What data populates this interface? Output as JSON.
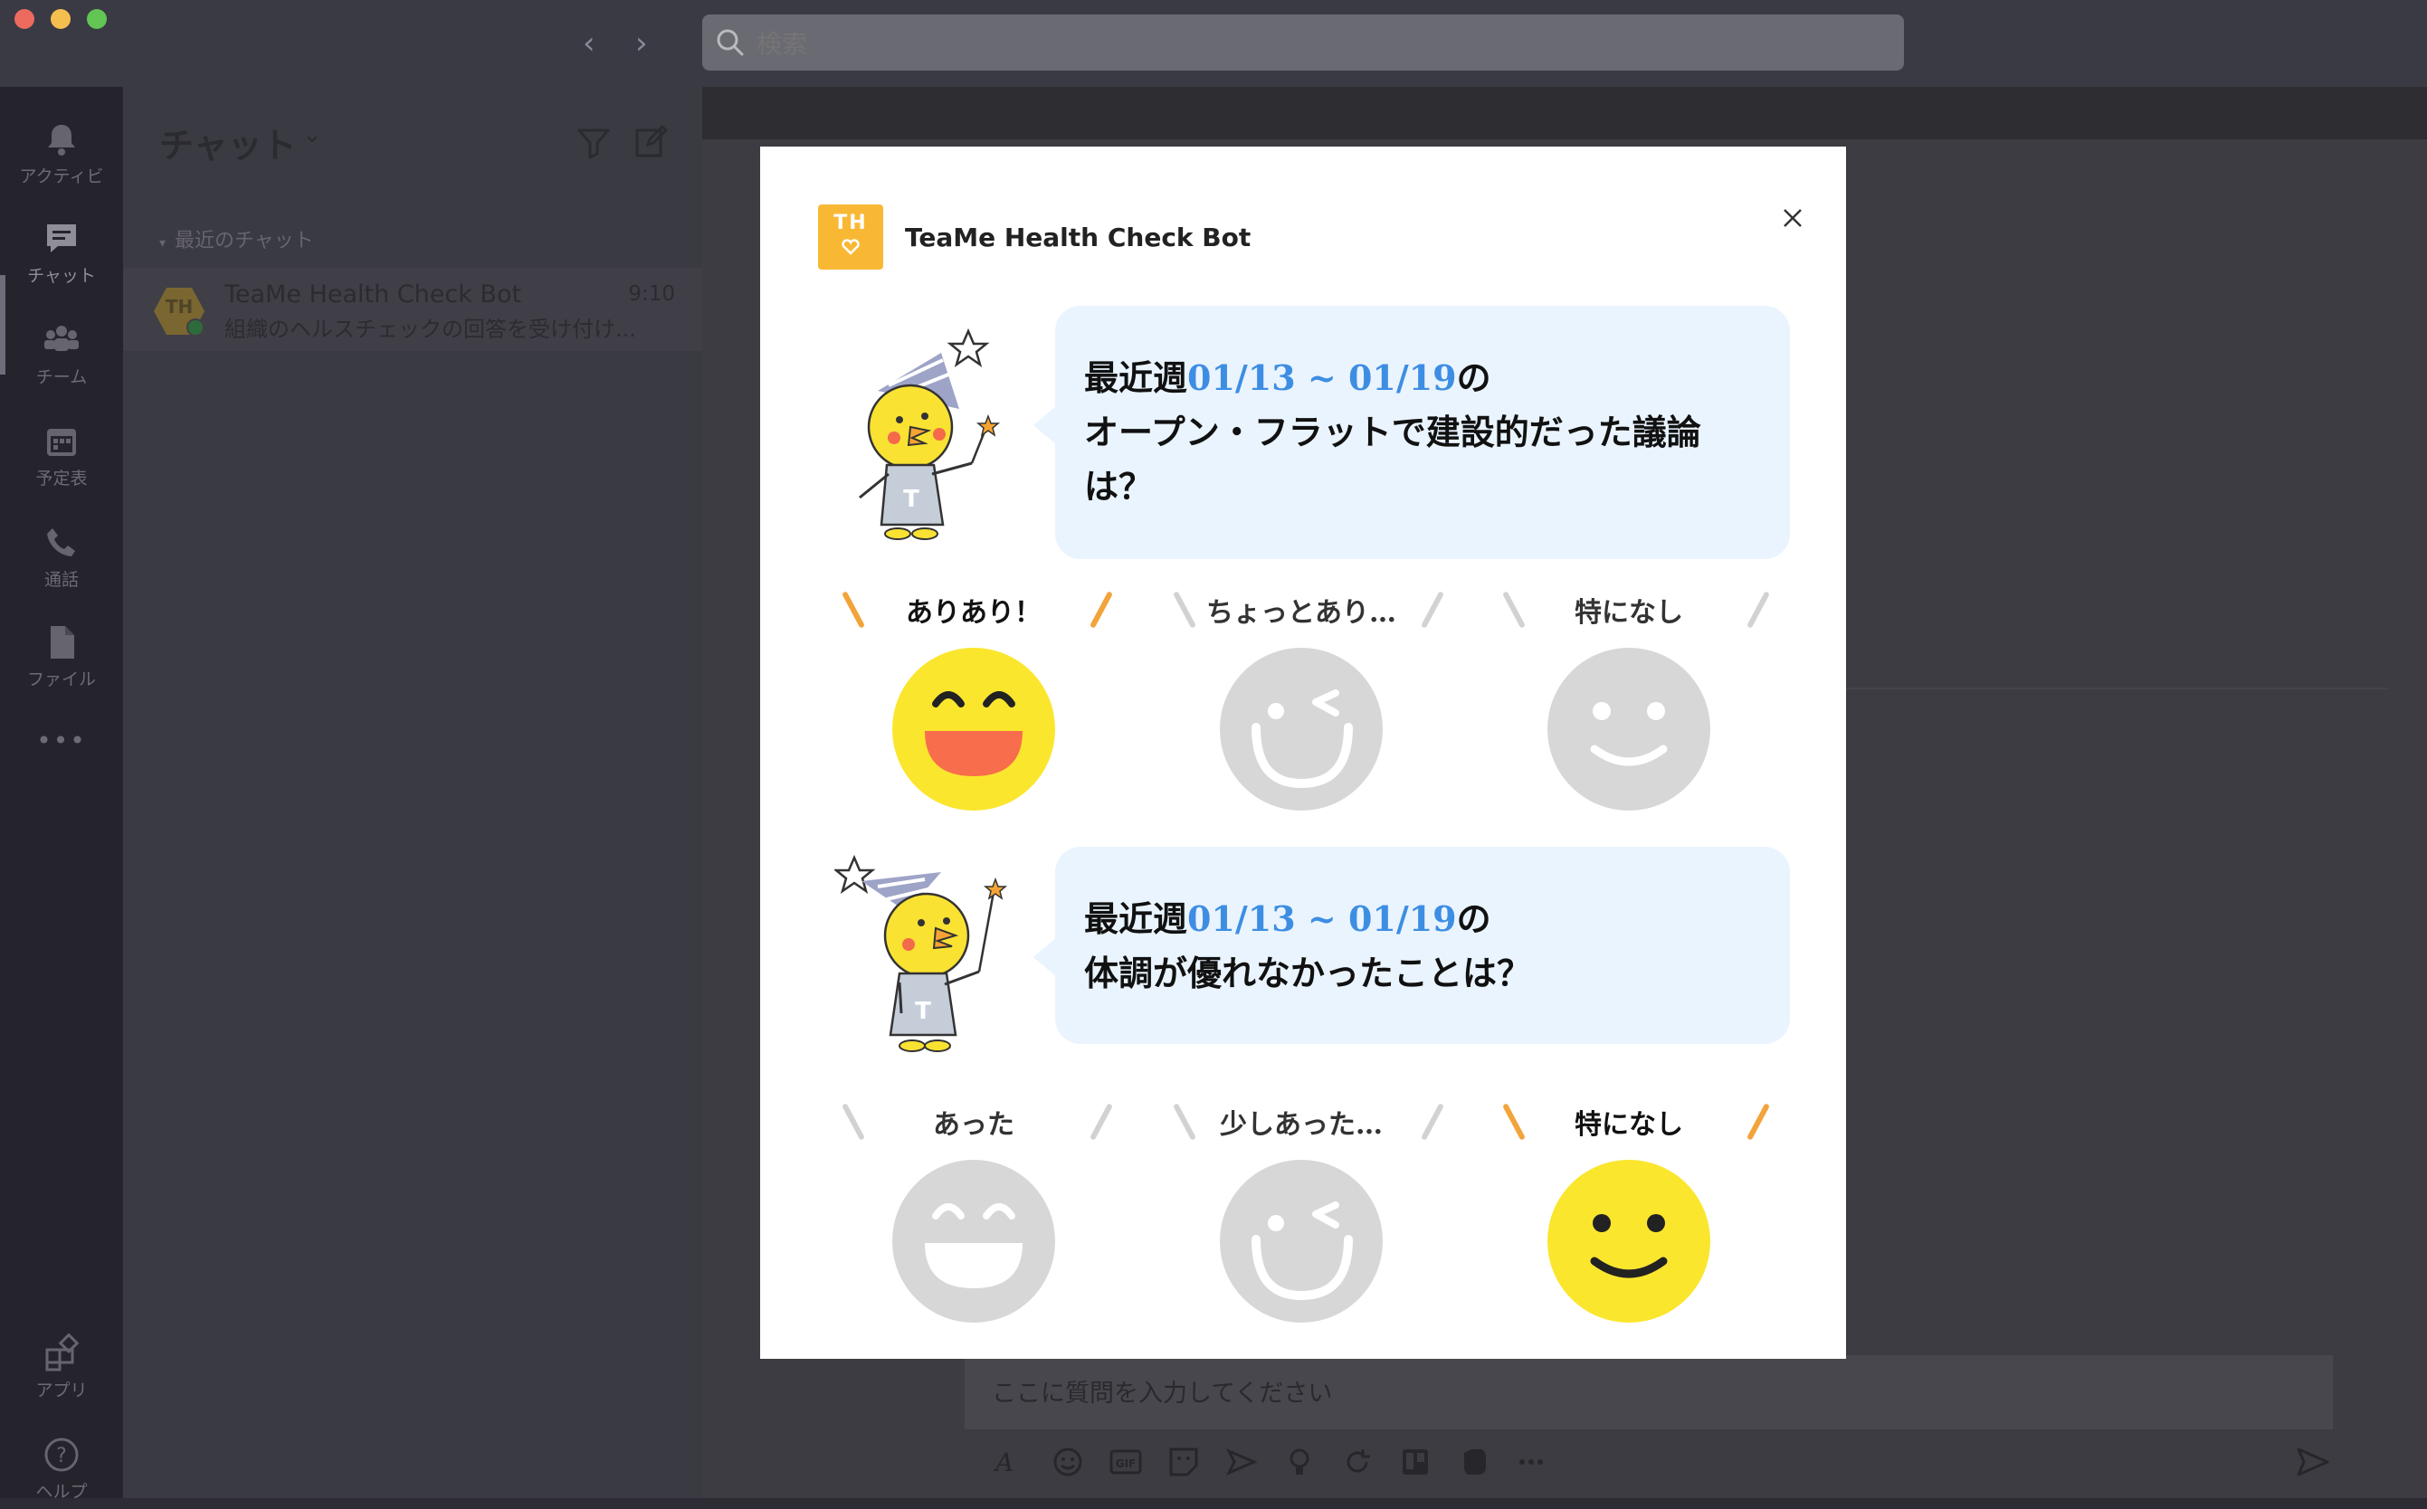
{
  "titlebar": {
    "search_placeholder": "検索"
  },
  "rail": {
    "items": [
      {
        "label": "アクティビ",
        "icon": "bell-icon"
      },
      {
        "label": "チャット",
        "icon": "chat-icon"
      },
      {
        "label": "チーム",
        "icon": "team-icon"
      },
      {
        "label": "予定表",
        "icon": "calendar-icon"
      },
      {
        "label": "通話",
        "icon": "phone-icon"
      },
      {
        "label": "ファイル",
        "icon": "file-icon"
      },
      {
        "label": "•••",
        "icon": "more-icon"
      },
      {
        "label": "アプリ",
        "icon": "apps-icon"
      },
      {
        "label": "ヘルプ",
        "icon": "help-icon"
      }
    ]
  },
  "chatlist": {
    "title": "チャット",
    "section_label": "最近のチャット",
    "chats": [
      {
        "avatar": "TH",
        "name": "TeaMe Health Check Bot",
        "time": "9:10",
        "preview": "組織のヘルスチェックの回答を受け付け..."
      }
    ]
  },
  "composer": {
    "placeholder": "ここに質問を入力してください"
  },
  "modal": {
    "bot_logo_text": "TH",
    "bot_name": "TeaMe Health Check Bot",
    "accent_color": "#f9b834",
    "questions": [
      {
        "prefix": "最近週",
        "date_range": "01/13 ~ 01/19",
        "suffix": "の",
        "line2": "オープン・フラットで建設的だった議論",
        "line3": "は？",
        "options": [
          {
            "label": "ありあり！",
            "selected": true,
            "face": "laughing-face-icon"
          },
          {
            "label": "ちょっとあり…",
            "selected": false,
            "face": "wink-face-icon"
          },
          {
            "label": "特になし",
            "selected": false,
            "face": "smile-face-icon"
          }
        ]
      },
      {
        "prefix": "最近週",
        "date_range": "01/13 ~ 01/19",
        "suffix": "の",
        "line2": "体調が優れなかったことは？",
        "line3": "",
        "options": [
          {
            "label": "あった",
            "selected": false,
            "face": "laughing-face-icon"
          },
          {
            "label": "少しあった…",
            "selected": false,
            "face": "wink-face-icon"
          },
          {
            "label": "特になし",
            "selected": true,
            "face": "smile-face-icon"
          }
        ]
      }
    ]
  }
}
